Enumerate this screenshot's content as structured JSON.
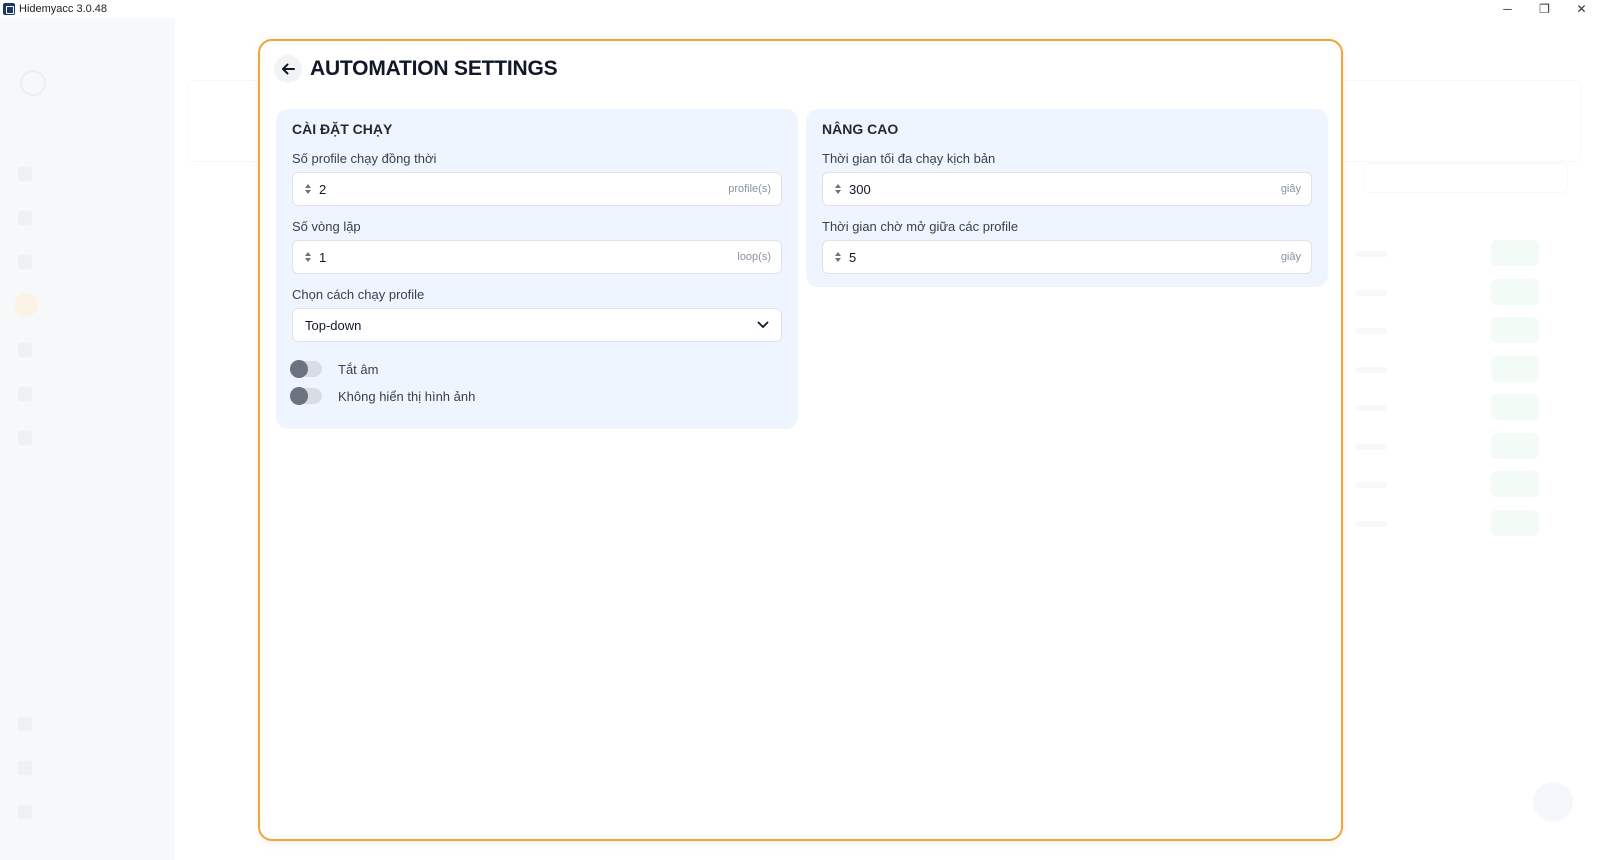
{
  "window": {
    "title": "Hidemyacc 3.0.48",
    "controls": {
      "minimize": "─",
      "restore": "❐",
      "close": "✕"
    }
  },
  "modal": {
    "title": "AUTOMATION SETTINGS",
    "accent_color": "#f2a33a",
    "run_settings": {
      "heading": "CÀI ĐẶT CHẠY",
      "concurrent_label": "Số profile chạy đồng thời",
      "concurrent_value": "2",
      "concurrent_unit": "profile(s)",
      "loops_label": "Số vòng lặp",
      "loops_value": "1",
      "loops_unit": "loop(s)",
      "run_order_label": "Chọn cách chạy profile",
      "run_order_value": "Top-down",
      "mute_label": "Tắt âm",
      "mute_on": false,
      "no_images_label": "Không hiển thị hình ảnh",
      "no_images_on": false
    },
    "advanced": {
      "heading": "NÂNG CAO",
      "max_time_label": "Thời gian tối đa chạy kịch bản",
      "max_time_value": "300",
      "max_time_unit": "giây",
      "wait_label": "Thời gian chờ mở giữa các profile",
      "wait_value": "5",
      "wait_unit": "giây"
    }
  }
}
